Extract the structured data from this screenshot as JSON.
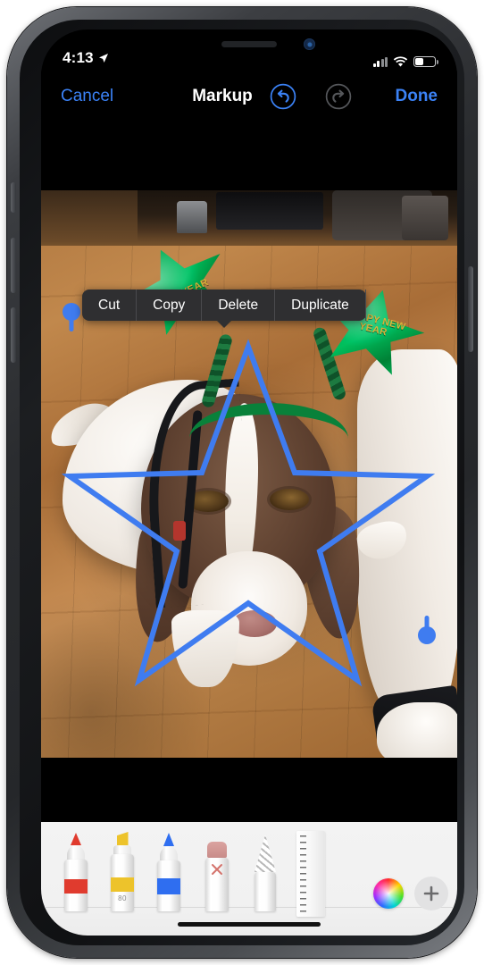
{
  "status_bar": {
    "time": "4:13",
    "location_icon": "location-arrow-icon",
    "cellular_icon": "cellular-bars-icon",
    "cellular_bars_filled": 2,
    "wifi_icon": "wifi-icon",
    "battery_icon": "battery-icon",
    "battery_level_pct": 36
  },
  "navbar": {
    "cancel_label": "Cancel",
    "title": "Markup",
    "undo_label": "undo-icon",
    "redo_label": "redo-icon",
    "undo_enabled": "true",
    "redo_enabled": "false",
    "done_label": "Done",
    "accent_color": "#3b82f6",
    "disabled_color": "#57595d"
  },
  "context_menu": {
    "items": [
      {
        "label": "Cut"
      },
      {
        "label": "Copy"
      },
      {
        "label": "Delete"
      },
      {
        "label": "Duplicate"
      }
    ],
    "background_color": "#2f2f31"
  },
  "canvas": {
    "annotation": {
      "shape": "star",
      "stroke_color": "#3f7cf0",
      "stroke_width": 6,
      "selected": "true"
    },
    "handles": [
      {
        "name": "selection-handle-top-left",
        "orientation": "down"
      },
      {
        "name": "selection-handle-bottom-right",
        "orientation": "up"
      }
    ],
    "photo": {
      "subject": "dog-with-happy-new-year-headband",
      "foil_star_left_text": "NEW YEAR",
      "foil_star_right_text": "HAPPY NEW YEAR",
      "foil_color": "#1fae6a",
      "foil_text_color": "#d9b23a"
    }
  },
  "tool_tray": {
    "tools": [
      {
        "name": "pen-tool",
        "label": "",
        "color": "#e03b2e"
      },
      {
        "name": "highlighter-tool",
        "label": "80",
        "color": "#edc32b"
      },
      {
        "name": "pencil-tool",
        "label": "",
        "color": "#2f6ef0"
      },
      {
        "name": "eraser-tool",
        "label": "",
        "color": "#d08c8c"
      },
      {
        "name": "lasso-tool",
        "label": "",
        "color": "#b9b9b9"
      },
      {
        "name": "ruler-tool",
        "label": "",
        "color": "#6f6f6f"
      }
    ],
    "color_wheel_label": "color-wheel-icon",
    "add_button_label": "+",
    "background_color": "#f1f1f1"
  },
  "home_indicator": {
    "label": "home-indicator"
  }
}
